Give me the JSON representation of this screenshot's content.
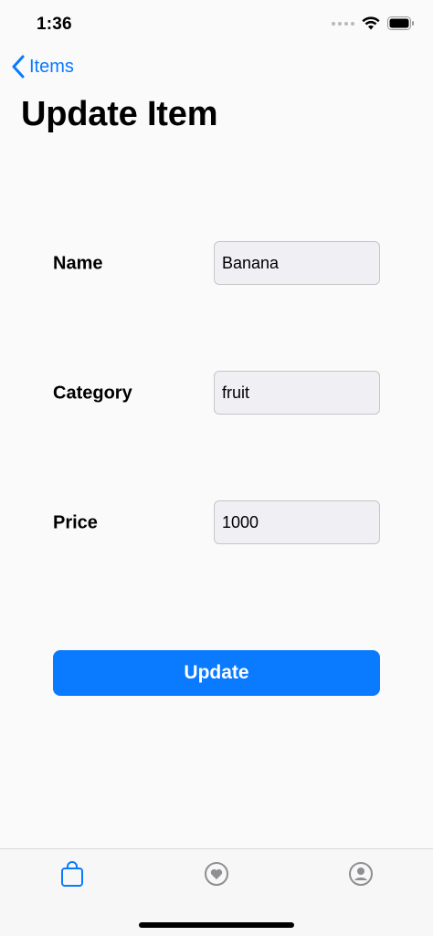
{
  "status_bar": {
    "time": "1:36"
  },
  "nav": {
    "back_label": "Items",
    "title": "Update Item"
  },
  "form": {
    "fields": [
      {
        "label": "Name",
        "value": "Banana"
      },
      {
        "label": "Category",
        "value": "fruit"
      },
      {
        "label": "Price",
        "value": "1000"
      }
    ],
    "submit_label": "Update"
  },
  "tab_bar": {
    "tabs": [
      {
        "icon": "bag-icon",
        "selected": true
      },
      {
        "icon": "heart-circle-icon",
        "selected": false
      },
      {
        "icon": "person-circle-icon",
        "selected": false
      }
    ]
  },
  "colors": {
    "accent": "#0a7aff",
    "inactive_tab": "#8e8e93",
    "input_background": "#efeff4"
  }
}
